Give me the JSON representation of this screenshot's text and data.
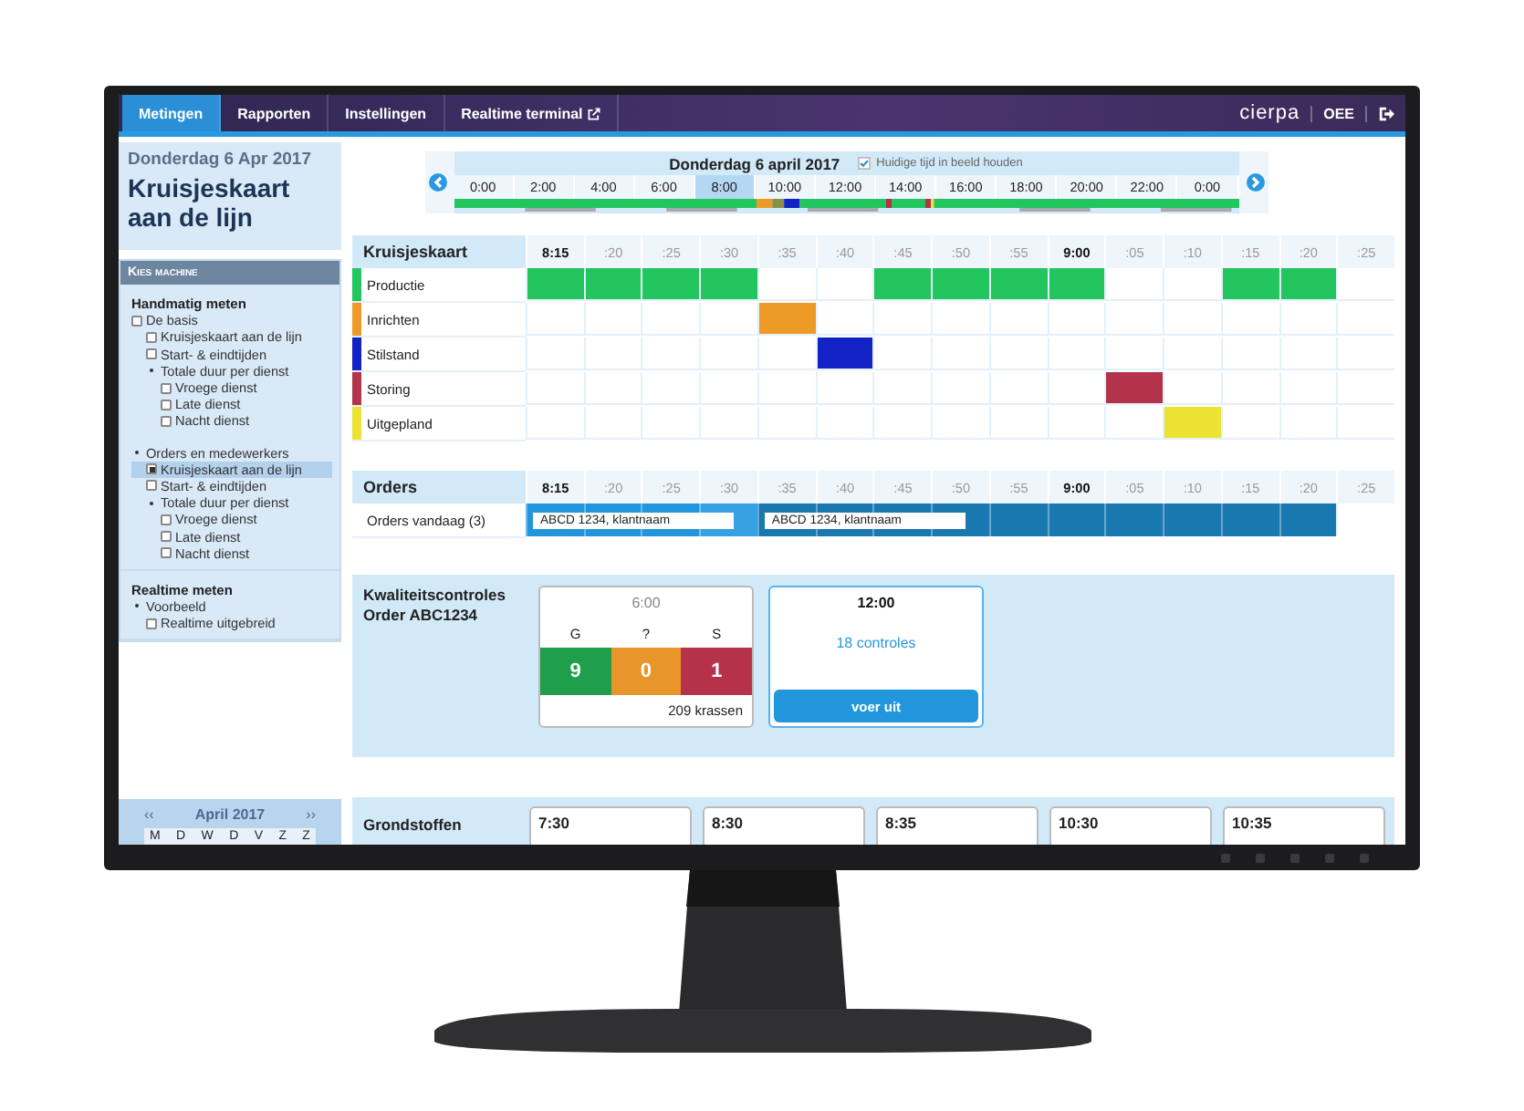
{
  "nav": {
    "tabs": [
      {
        "label": "Metingen",
        "selected": true,
        "external": false
      },
      {
        "label": "Rapporten",
        "selected": false,
        "external": false
      },
      {
        "label": "Instellingen",
        "selected": false,
        "external": false
      },
      {
        "label": "Realtime terminal",
        "selected": false,
        "external": true
      }
    ],
    "logo": "cierpa",
    "product": "OEE"
  },
  "sidebar": {
    "date": "Donderdag 6 Apr 2017",
    "title": "Kruisjeskaart aan de lijn",
    "machine_header": "Kies machine",
    "groups": [
      {
        "title": "Handmatig meten",
        "items": [
          {
            "label": "De basis",
            "kind": "checkbox",
            "checked": false,
            "selected": false,
            "children": [
              {
                "label": "Kruisjeskaart aan de lijn",
                "kind": "checkbox",
                "checked": false,
                "selected": false
              },
              {
                "label": "Start- & eindtijden",
                "kind": "checkbox",
                "checked": false,
                "selected": false
              },
              {
                "label": "Totale duur per dienst",
                "kind": "bullet",
                "selected": false,
                "children": [
                  {
                    "label": "Vroege dienst",
                    "kind": "checkbox",
                    "checked": false,
                    "selected": false
                  },
                  {
                    "label": "Late dienst",
                    "kind": "checkbox",
                    "checked": false,
                    "selected": false
                  },
                  {
                    "label": "Nacht dienst",
                    "kind": "checkbox",
                    "checked": false,
                    "selected": false
                  }
                ]
              }
            ]
          },
          {
            "label": "Orders en medewerkers",
            "kind": "bullet",
            "selected": false,
            "children": [
              {
                "label": "Kruisjeskaart aan de lijn",
                "kind": "checkbox",
                "checked": true,
                "selected": true
              },
              {
                "label": "Start- & eindtijden",
                "kind": "checkbox",
                "checked": false,
                "selected": false
              },
              {
                "label": "Totale duur per dienst",
                "kind": "bullet",
                "selected": false,
                "children": [
                  {
                    "label": "Vroege dienst",
                    "kind": "checkbox",
                    "checked": false,
                    "selected": false
                  },
                  {
                    "label": "Late dienst",
                    "kind": "checkbox",
                    "checked": false,
                    "selected": false
                  },
                  {
                    "label": "Nacht dienst",
                    "kind": "checkbox",
                    "checked": false,
                    "selected": false
                  }
                ]
              }
            ]
          }
        ]
      },
      {
        "title": "Realtime meten",
        "items": [
          {
            "label": "Voorbeeld",
            "kind": "bullet",
            "selected": false,
            "children": [
              {
                "label": "Realtime uitgebreid",
                "kind": "checkbox",
                "checked": false,
                "selected": false
              }
            ]
          }
        ]
      }
    ],
    "calendar": {
      "prev": "‹‹",
      "title": "April 2017",
      "next": "››",
      "weekdays": [
        "M",
        "D",
        "W",
        "D",
        "V",
        "Z",
        "Z"
      ]
    }
  },
  "timeline": {
    "date": "Donderdag 6 april 2017",
    "keep_current": {
      "label": "Huidige tijd in beeld houden",
      "checked": true
    },
    "hours": [
      {
        "label": "0:00",
        "selected": false
      },
      {
        "label": "2:00",
        "selected": false
      },
      {
        "label": "4:00",
        "selected": false
      },
      {
        "label": "6:00",
        "selected": false
      },
      {
        "label": "8:00",
        "selected": true
      },
      {
        "label": "10:00",
        "selected": false
      },
      {
        "label": "12:00",
        "selected": false
      },
      {
        "label": "14:00",
        "selected": false
      },
      {
        "label": "16:00",
        "selected": false
      },
      {
        "label": "18:00",
        "selected": false
      },
      {
        "label": "20:00",
        "selected": false
      },
      {
        "label": "22:00",
        "selected": false
      },
      {
        "label": "0:00",
        "selected": false
      }
    ]
  },
  "checklist": {
    "title": "Kruisjeskaart",
    "times": [
      {
        "label": "8:15",
        "major": true
      },
      {
        "label": ":20",
        "major": false
      },
      {
        "label": ":25",
        "major": false
      },
      {
        "label": ":30",
        "major": false
      },
      {
        "label": ":35",
        "major": false
      },
      {
        "label": ":40",
        "major": false
      },
      {
        "label": ":45",
        "major": false
      },
      {
        "label": ":50",
        "major": false
      },
      {
        "label": ":55",
        "major": false
      },
      {
        "label": "9:00",
        "major": true
      },
      {
        "label": ":05",
        "major": false
      },
      {
        "label": ":10",
        "major": false
      },
      {
        "label": ":15",
        "major": false
      },
      {
        "label": ":20",
        "major": false
      },
      {
        "label": ":25",
        "major": false
      }
    ],
    "rows": [
      {
        "label": "Productie",
        "color": "#22c55e",
        "cells": [
          true,
          true,
          true,
          true,
          false,
          false,
          true,
          true,
          true,
          true,
          false,
          false,
          true,
          true,
          false
        ]
      },
      {
        "label": "Inrichten",
        "color": "#ee9a26",
        "cells": [
          false,
          false,
          false,
          false,
          true,
          false,
          false,
          false,
          false,
          false,
          false,
          false,
          false,
          false,
          false
        ]
      },
      {
        "label": "Stilstand",
        "color": "#1322c4",
        "cells": [
          false,
          false,
          false,
          false,
          false,
          true,
          false,
          false,
          false,
          false,
          false,
          false,
          false,
          false,
          false
        ]
      },
      {
        "label": "Storing",
        "color": "#b3334b",
        "cells": [
          false,
          false,
          false,
          false,
          false,
          false,
          false,
          false,
          false,
          false,
          true,
          false,
          false,
          false,
          false
        ]
      },
      {
        "label": "Uitgepland",
        "color": "#ece232",
        "cells": [
          false,
          false,
          false,
          false,
          false,
          false,
          false,
          false,
          false,
          false,
          false,
          true,
          false,
          false,
          false
        ]
      }
    ]
  },
  "orders": {
    "title": "Orders",
    "times": [
      {
        "label": "8:15",
        "major": true
      },
      {
        "label": ":20",
        "major": false
      },
      {
        "label": ":25",
        "major": false
      },
      {
        "label": ":30",
        "major": false
      },
      {
        "label": ":35",
        "major": false
      },
      {
        "label": ":40",
        "major": false
      },
      {
        "label": ":45",
        "major": false
      },
      {
        "label": ":50",
        "major": false
      },
      {
        "label": ":55",
        "major": false
      },
      {
        "label": "9:00",
        "major": true
      },
      {
        "label": ":05",
        "major": false
      },
      {
        "label": ":10",
        "major": false
      },
      {
        "label": ":15",
        "major": false
      },
      {
        "label": ":20",
        "major": false
      },
      {
        "label": ":25",
        "major": false
      }
    ],
    "rows": [
      {
        "label": "Orders vandaag (3)",
        "cells": [
          {
            "kind": "current",
            "label": "ABCD 1234, klantnaam"
          },
          {
            "kind": "current"
          },
          {
            "kind": "current"
          },
          {
            "kind": "handover"
          },
          {
            "kind": "next",
            "label": "ABCD 1234, klantnaam"
          },
          {
            "kind": "next"
          },
          {
            "kind": "next"
          },
          {
            "kind": "next"
          },
          {
            "kind": "next"
          },
          {
            "kind": "next"
          },
          {
            "kind": "next"
          },
          {
            "kind": "next"
          },
          {
            "kind": "next"
          },
          {
            "kind": "next"
          },
          {
            "kind": "none"
          }
        ]
      }
    ]
  },
  "quality": {
    "title": "Kwaliteitscontroles",
    "subtitle": "Order ABC1234",
    "cards": [
      {
        "kind": "result",
        "time": "6:00",
        "columns": [
          {
            "label": "G",
            "value": "9",
            "color": "#1f9e4b"
          },
          {
            "label": "?",
            "value": "0",
            "color": "#e8962a"
          },
          {
            "label": "S",
            "value": "1",
            "color": "#b5324a"
          }
        ],
        "footer": "209 krassen"
      },
      {
        "kind": "pending",
        "time": "12:00",
        "link": "18 controles",
        "button": "voer uit"
      }
    ]
  },
  "materials": {
    "title": "Grondstoffen",
    "cards": [
      {
        "time": "7:30"
      },
      {
        "time": "8:30"
      },
      {
        "time": "8:35"
      },
      {
        "time": "10:30"
      },
      {
        "time": "10:35"
      }
    ]
  }
}
